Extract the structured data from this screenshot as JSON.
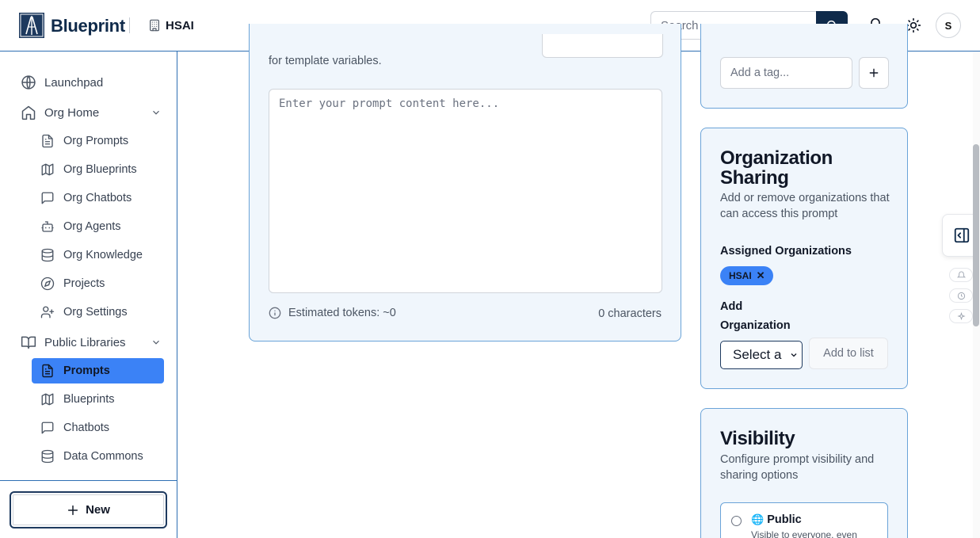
{
  "header": {
    "app_name": "Blueprint",
    "org_name": "HSAI",
    "search_placeholder": "Search ...",
    "avatar_initial": "S"
  },
  "sidebar": {
    "items": [
      {
        "label": "Launchpad",
        "icon": "globe-icon"
      },
      {
        "label": "Org Home",
        "icon": "home-icon",
        "expanded": true
      },
      {
        "label": "Org Prompts",
        "icon": "file-text-icon"
      },
      {
        "label": "Org Blueprints",
        "icon": "map-icon"
      },
      {
        "label": "Org Chatbots",
        "icon": "message-square-icon"
      },
      {
        "label": "Org Agents",
        "icon": "bot-icon"
      },
      {
        "label": "Org Knowledge",
        "icon": "database-icon"
      },
      {
        "label": "Projects",
        "icon": "compass-icon"
      },
      {
        "label": "Org Settings",
        "icon": "user-plus-icon"
      },
      {
        "label": "Public Libraries",
        "icon": "book-open-icon",
        "expanded": true
      },
      {
        "label": "Prompts",
        "icon": "file-text-icon",
        "active": true
      },
      {
        "label": "Blueprints",
        "icon": "map-icon"
      },
      {
        "label": "Chatbots",
        "icon": "message-square-icon"
      },
      {
        "label": "Data Commons",
        "icon": "database-icon"
      }
    ],
    "new_button_label": "New"
  },
  "editor": {
    "desc_partial": "for template variables.",
    "prompt_placeholder": "Enter your prompt content here...",
    "estimated_tokens": "Estimated tokens: ~0",
    "characters": "0 characters"
  },
  "tags": {
    "input_placeholder": "Add a tag..."
  },
  "org_sharing": {
    "title": "Organization Sharing",
    "description": "Add or remove organizations that can access this prompt",
    "assigned_label": "Assigned Organizations",
    "assigned": [
      "HSAI"
    ],
    "add_label": "Add Organization",
    "select_value": "Select a",
    "add_button": "Add to list"
  },
  "visibility": {
    "title": "Visibility",
    "description": "Configure prompt visibility and sharing options",
    "option_label": "Public",
    "option_desc": "Visible to everyone, even"
  },
  "colors": {
    "accent": "#3b82f6",
    "brand_dark": "#0f2a4a",
    "card_bg": "#f0f6fc",
    "card_border": "#6aa3d8"
  }
}
